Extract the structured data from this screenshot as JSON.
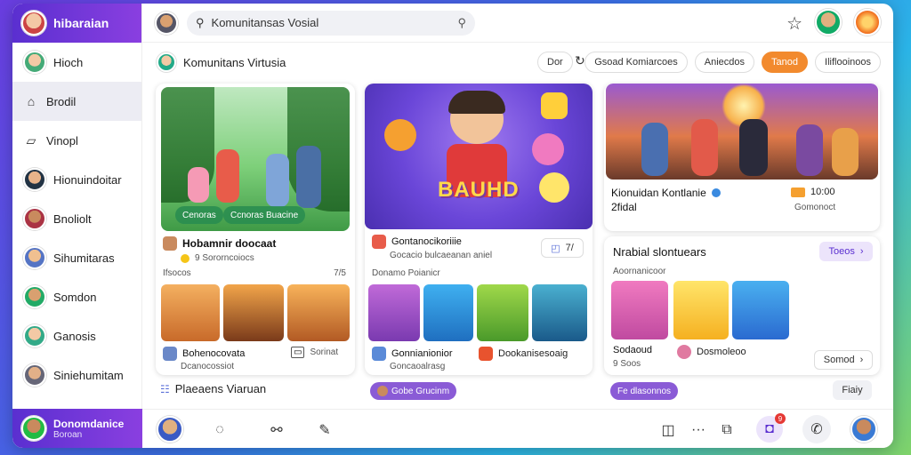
{
  "app": {
    "title": "hibaraian"
  },
  "sidebar": {
    "items": [
      {
        "label": "Hioch",
        "icon": "avatar"
      },
      {
        "label": "Brodil",
        "icon": "home-icon"
      },
      {
        "label": "Vinopl",
        "icon": "bookmark-icon"
      },
      {
        "label": "Hionuindoitar",
        "icon": "avatar"
      },
      {
        "label": "Bnoliolt",
        "icon": "avatar"
      },
      {
        "label": "Sihumitaras",
        "icon": "avatar"
      },
      {
        "label": "Somdon",
        "icon": "avatar"
      },
      {
        "label": "Ganosis",
        "icon": "avatar"
      },
      {
        "label": "Siniehumitam",
        "icon": "avatar"
      }
    ],
    "user": {
      "name": "Donomdanice",
      "sub": "Boroan"
    }
  },
  "header": {
    "search_value": "Komunitansas Vosial"
  },
  "subheader": {
    "title": "Komunitans Virtusia",
    "btn1": "Dor",
    "filters": [
      "Gsoad Komiarcoes",
      "Aniecdos",
      "Tanod",
      "Iliflooinoos"
    ]
  },
  "card1": {
    "chip1": "Cenoras",
    "chip2": "Ccnoras Buacine",
    "title": "Hobamnir doocaat",
    "sub": "9 Sororncoiocs",
    "meta": "Ifsocos",
    "meta_right": "7/5",
    "foot_label": "Bohenocovata",
    "foot_sub": "Dcanocossiot",
    "foot_btn": "Sorinat"
  },
  "card2": {
    "hero_text": "BAUHD",
    "title": "Gontanocikoriiie",
    "sub": "Gocacio bulcaeanan aniel",
    "btn": "7/",
    "meta": "Donamo Poianicr",
    "foot_label": "Gonnianionior",
    "foot_sub": "Goncaoalrasg",
    "foot_label2": "Dookanisesoaig"
  },
  "card3": {
    "title": "Kionuidan Kontlanie",
    "sub": "2fidal",
    "badge": "10:00",
    "badge_sub": "Gomonoct"
  },
  "card4": {
    "title": "Nrabial slontuears",
    "sub": "Aoornanicoor",
    "btn": "Toeos",
    "foot_label": "Sodaoud",
    "foot_sub": "9 Soos",
    "foot_label2": "Dosmoleoo",
    "foot_btn": "Somod"
  },
  "footer_row": {
    "label": "Plaeaens Viaruan",
    "pill1": "Gobe Grucinm",
    "pill2": "Fe dlasonnos",
    "btn": "Fiaiy"
  },
  "bottombar": {
    "notif": "9"
  },
  "colors": {
    "accent": "#5a2fd0",
    "orange": "#f28a2e",
    "purple_pill": "#8a5bd6"
  }
}
